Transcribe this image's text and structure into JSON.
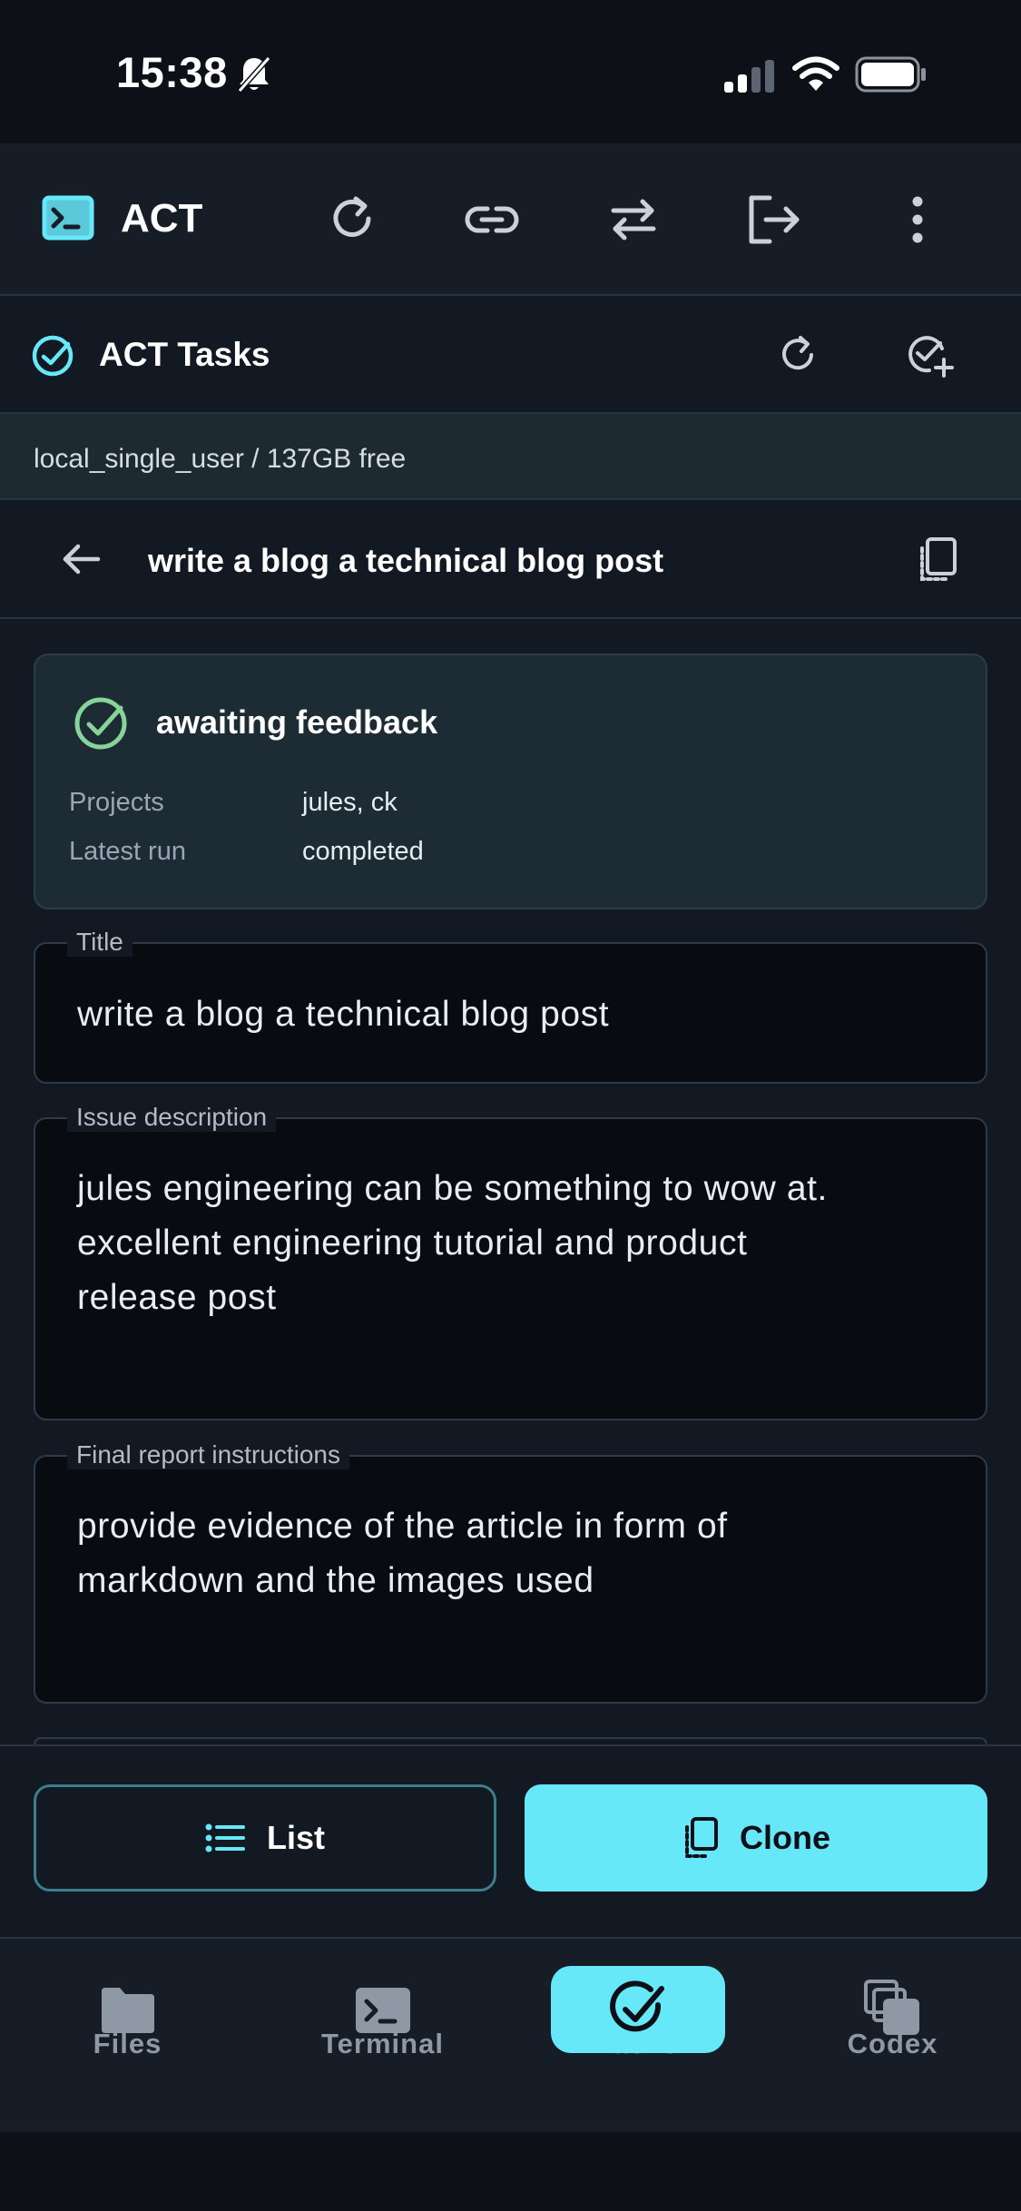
{
  "status_bar": {
    "time": "15:38"
  },
  "app_bar": {
    "title": "ACT"
  },
  "tasks_bar": {
    "title": "ACT Tasks"
  },
  "info_bar": {
    "text": "local_single_user / 137GB free"
  },
  "detail_header": {
    "title": "write a blog a technical blog post"
  },
  "status_card": {
    "status": "awaiting feedback",
    "rows": [
      {
        "key": "Projects",
        "value": "jules, ck"
      },
      {
        "key": "Latest run",
        "value": "completed"
      }
    ]
  },
  "fields": {
    "title": {
      "label": "Title",
      "value": "write a blog a technical blog post"
    },
    "issue": {
      "label": "Issue description",
      "line1": "jules engineering can be something to wow at.",
      "line2": "excellent engineering tutorial and product",
      "line3": "release post"
    },
    "report": {
      "label": "Final report instructions",
      "line1": "provide evidence of the article in form of",
      "line2": "markdown and the images used"
    }
  },
  "actions": {
    "list_label": "List",
    "clone_label": "Clone"
  },
  "nav": {
    "items": [
      {
        "label": "Files"
      },
      {
        "label": "Terminal"
      },
      {
        "label": "Tasks"
      },
      {
        "label": "Codex"
      }
    ]
  },
  "colors": {
    "accent": "#67e8f9",
    "success": "#86d49a",
    "background": "#121922"
  }
}
